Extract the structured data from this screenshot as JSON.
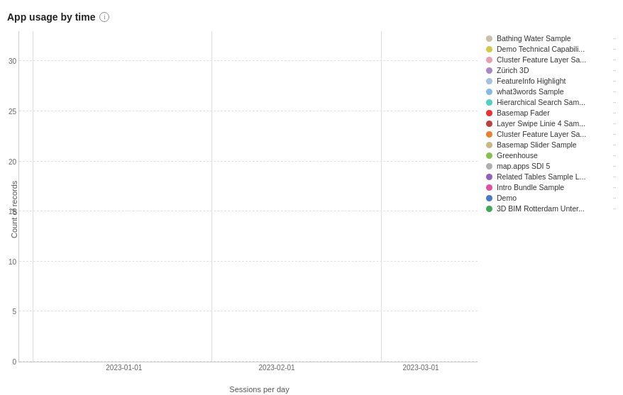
{
  "title": "App usage by time",
  "yAxis": {
    "label": "Count of records",
    "ticks": [
      0,
      5,
      10,
      15,
      20,
      25,
      30
    ]
  },
  "xAxis": {
    "label": "Sessions per day",
    "ticks": [
      "2023-01-01",
      "2023-02-01",
      "2023-03-01"
    ]
  },
  "legend": [
    {
      "label": "Bathing Water Sample",
      "color": "#c8c0a8"
    },
    {
      "label": "Demo Technical Capabili...",
      "color": "#d4c84a"
    },
    {
      "label": "Cluster Feature Layer Sa...",
      "color": "#e8a0b0"
    },
    {
      "label": "Zürich 3D",
      "color": "#a888c8"
    },
    {
      "label": "FeatureInfo Highlight",
      "color": "#a8c0e0"
    },
    {
      "label": "what3words Sample",
      "color": "#88b8e8"
    },
    {
      "label": "Hierarchical Search Sam...",
      "color": "#50d0c0"
    },
    {
      "label": "Basemap Fader",
      "color": "#e83030"
    },
    {
      "label": "Layer Swipe Linie 4 Sam...",
      "color": "#b84040"
    },
    {
      "label": "Cluster Feature Layer Sa...",
      "color": "#e88030"
    },
    {
      "label": "Basemap Slider Sample",
      "color": "#c8b888"
    },
    {
      "label": "Greenhouse",
      "color": "#88c050"
    },
    {
      "label": "map.apps SDI 5",
      "color": "#b0b0b0"
    },
    {
      "label": "Related Tables Sample L...",
      "color": "#9060c0"
    },
    {
      "label": "Intro Bundle Sample",
      "color": "#e050a0"
    },
    {
      "label": "Demo",
      "color": "#4878c8"
    },
    {
      "label": "3D BIM Rotterdam Unter...",
      "color": "#40a858"
    }
  ],
  "infoIconLabel": "i"
}
